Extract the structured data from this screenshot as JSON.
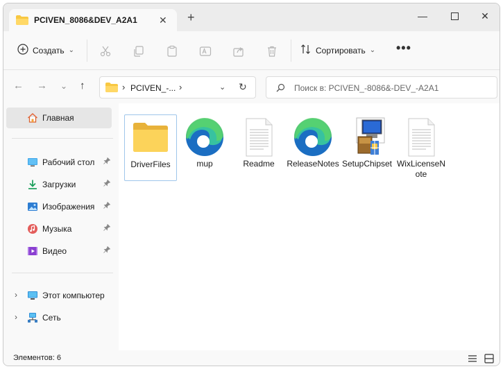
{
  "tab": {
    "title": "PCIVEN_8086&DEV_A2A1",
    "close": "✕",
    "new_tab": "+"
  },
  "window_controls": {
    "minimize": "—",
    "maximize": "☐",
    "close": "✕"
  },
  "toolbar": {
    "create_label": "Создать",
    "create_caret": "⌄",
    "sort_label": "Сортировать",
    "sort_caret": "⌄",
    "more_label": "•••",
    "icons": [
      "cut-icon",
      "copy-icon",
      "paste-icon",
      "rename-icon",
      "share-icon",
      "delete-icon"
    ]
  },
  "navigation": {
    "back": "←",
    "forward": "→",
    "recent": "⌄",
    "up": "↑",
    "address_chevron": "›",
    "address_path": "PCIVEN_-...",
    "address_chevron_end": "›",
    "address_dropdown": "⌄",
    "refresh": "↻",
    "search_placeholder": "Поиск в: PCIVEN_-8086&-DEV_-A2A1"
  },
  "sidebar": {
    "home": {
      "label": "Главная",
      "icon": "home-icon"
    },
    "pinned": [
      {
        "label": "Рабочий стол",
        "icon": "desktop-icon",
        "pin": "📌"
      },
      {
        "label": "Загрузки",
        "icon": "downloads-icon",
        "pin": "📌"
      },
      {
        "label": "Изображения",
        "icon": "pictures-icon",
        "pin": "📌"
      },
      {
        "label": "Музыка",
        "icon": "music-icon",
        "pin": "📌"
      },
      {
        "label": "Видео",
        "icon": "videos-icon",
        "pin": "📌"
      }
    ],
    "devices": [
      {
        "label": "Этот компьютер",
        "icon": "this-pc-icon",
        "chevron": "›"
      },
      {
        "label": "Сеть",
        "icon": "network-icon",
        "chevron": "›"
      }
    ]
  },
  "files": [
    {
      "label": "DriverFiles",
      "icon": "folder-icon",
      "selected": true
    },
    {
      "label": "mup",
      "icon": "edge-icon"
    },
    {
      "label": "Readme",
      "icon": "text-document-icon"
    },
    {
      "label": "ReleaseNotes",
      "icon": "edge-icon"
    },
    {
      "label": "SetupChipset",
      "icon": "installer-icon"
    },
    {
      "label": "WixLicenseNote",
      "icon": "text-document-icon"
    }
  ],
  "status": {
    "count": "Элементов: 6"
  },
  "colors": {
    "accent": "#0067c0",
    "folder": "#f8c842",
    "selection": "#9fc6ea"
  }
}
